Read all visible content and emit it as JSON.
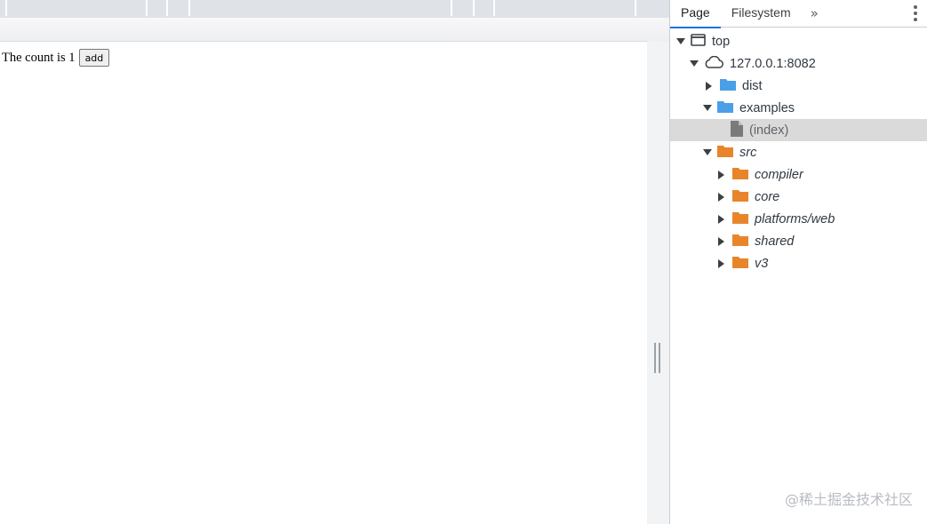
{
  "page": {
    "count_text": "The count is 1",
    "add_button_label": "add"
  },
  "devtools": {
    "tabs": [
      {
        "label": "Page",
        "active": true
      },
      {
        "label": "Filesystem",
        "active": false
      }
    ],
    "more_tabs_glyph": "»",
    "tree": {
      "top": "top",
      "origin": "127.0.0.1:8082",
      "dist": "dist",
      "examples": "examples",
      "index_file": "(index)",
      "src": "src",
      "compiler": "compiler",
      "core": "core",
      "platforms_web": "platforms/web",
      "shared": "shared",
      "v3": "v3"
    },
    "colors": {
      "folder_blue": "#4a9fe8",
      "folder_orange": "#e8852b",
      "accent": "#1a73e8"
    }
  },
  "watermark": "@稀土掘金技术社区"
}
